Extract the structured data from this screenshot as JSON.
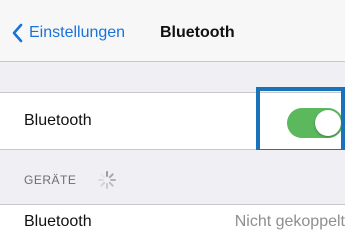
{
  "nav": {
    "back_label": "Einstellungen",
    "back_icon": "chevron-left-icon",
    "title": "Bluetooth"
  },
  "bluetooth_row": {
    "label": "Bluetooth",
    "toggle_on": true,
    "toggle_color": "#5bb85c",
    "highlight_color": "#1a73b8"
  },
  "devices_section": {
    "header": "GERÄTE",
    "spinner_icon": "activity-spinner-icon"
  },
  "devices": [
    {
      "name": "Bluetooth",
      "status": "Nicht gekoppelt"
    }
  ],
  "colors": {
    "accent": "#1a73d9",
    "group_background": "#efeff4"
  }
}
